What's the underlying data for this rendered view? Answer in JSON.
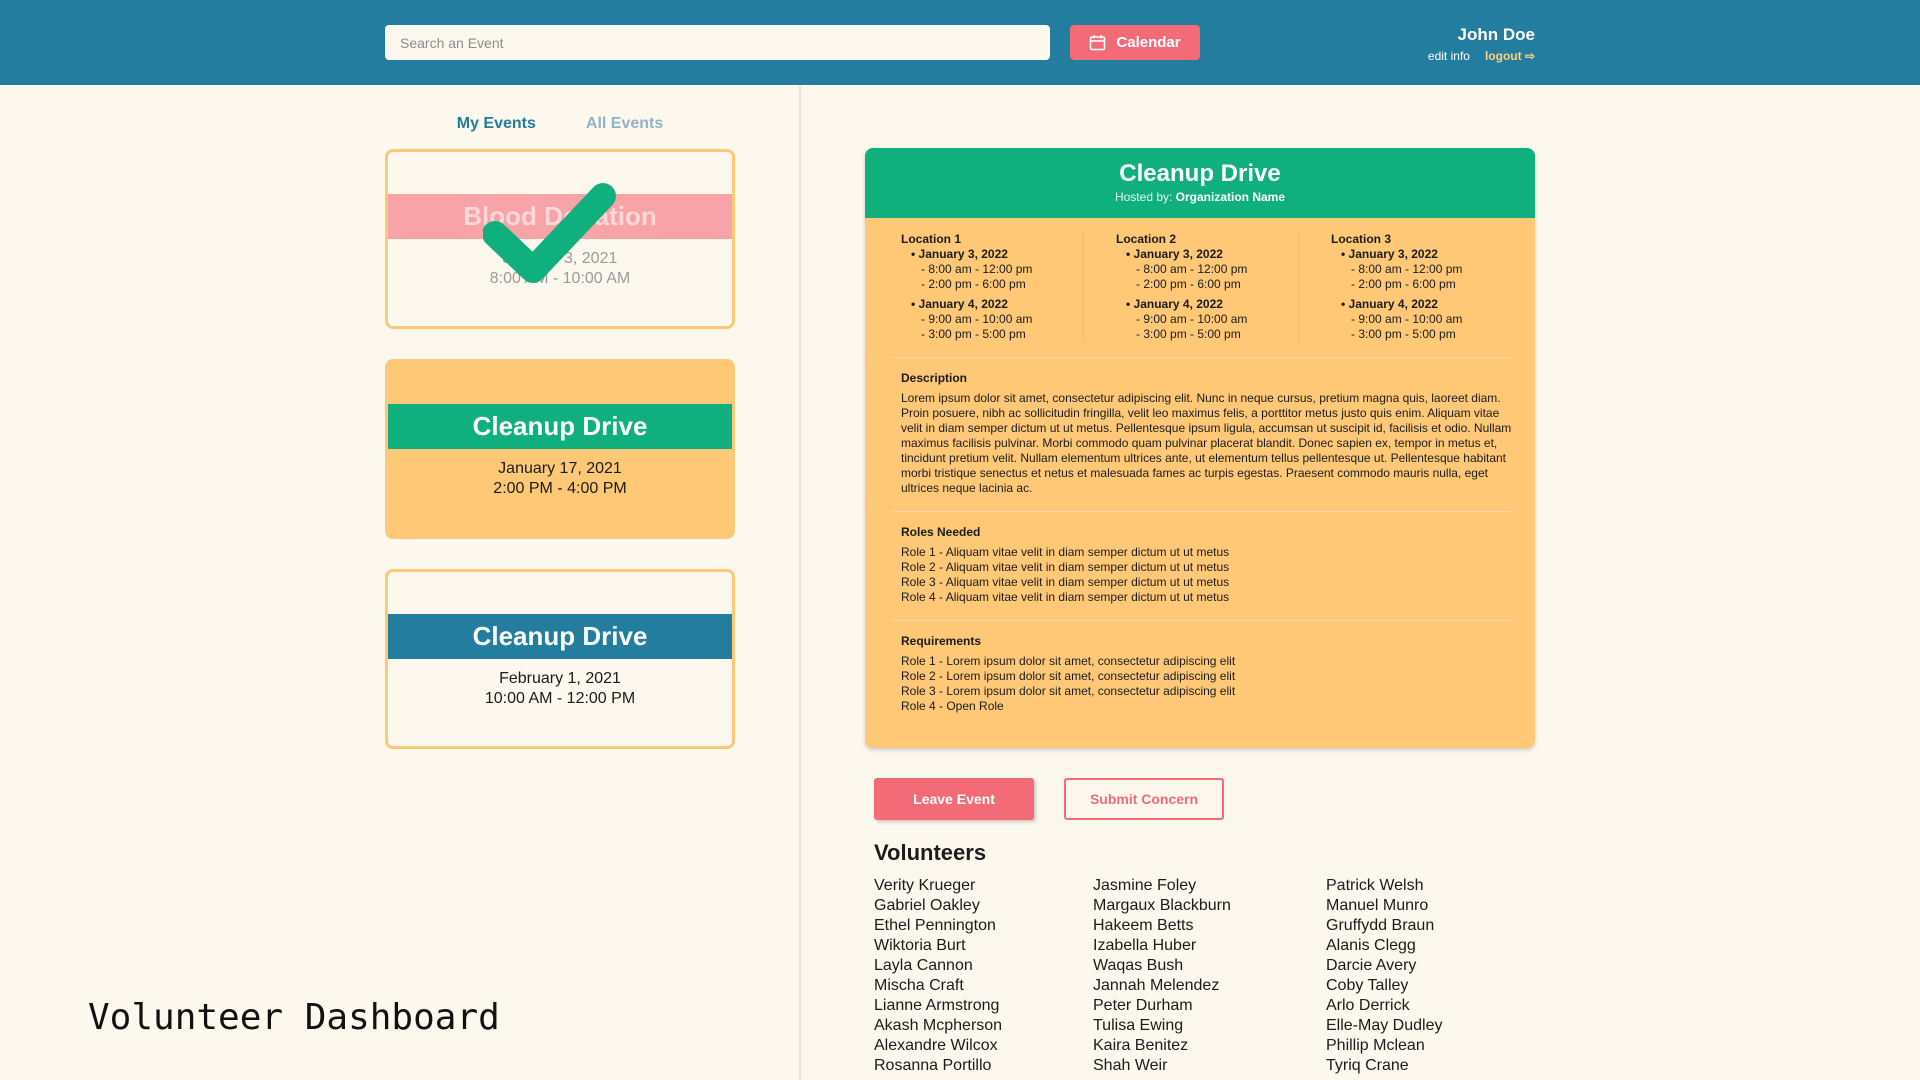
{
  "header": {
    "search_placeholder": "Search an Event",
    "calendar_label": "Calendar",
    "user_name": "John Doe",
    "edit_info": "edit info",
    "logout": "logout ⇨"
  },
  "tabs": {
    "my_events": "My Events",
    "all_events": "All Events"
  },
  "event_cards": [
    {
      "title": "Blood Donation",
      "date": "January 3, 2021",
      "time": "8:00 AM - 10:00 AM",
      "status": "completed"
    },
    {
      "title": "Cleanup Drive",
      "date": "January 17, 2021",
      "time": "2:00 PM - 4:00 PM",
      "status": "selected"
    },
    {
      "title": "Cleanup Drive",
      "date": "February 1, 2021",
      "time": "10:00 AM - 12:00 PM",
      "status": "upcoming"
    }
  ],
  "detail": {
    "title": "Cleanup Drive",
    "hosted_by_label": "Hosted by: ",
    "organization": "Organization Name",
    "locations": [
      {
        "name": "Location 1",
        "d1": "January 3, 2022",
        "d1t1": "8:00 am - 12:00 pm",
        "d1t2": "2:00 pm - 6:00 pm",
        "d2": "January 4, 2022",
        "d2t1": "9:00 am - 10:00 am",
        "d2t2": "3:00 pm - 5:00 pm"
      },
      {
        "name": "Location 2",
        "d1": "January 3, 2022",
        "d1t1": "8:00 am - 12:00 pm",
        "d1t2": "2:00 pm - 6:00 pm",
        "d2": "January 4, 2022",
        "d2t1": "9:00 am - 10:00 am",
        "d2t2": "3:00 pm - 5:00 pm"
      },
      {
        "name": "Location 3",
        "d1": "January 3, 2022",
        "d1t1": "8:00 am - 12:00 pm",
        "d1t2": "2:00 pm - 6:00 pm",
        "d2": "January 4, 2022",
        "d2t1": "9:00 am - 10:00 am",
        "d2t2": "3:00 pm - 5:00 pm"
      }
    ],
    "description_title": "Description",
    "description": "Lorem ipsum dolor sit amet, consectetur adipiscing elit. Nunc in neque cursus, pretium magna quis, laoreet diam. Proin posuere, nibh ac sollicitudin fringilla, velit leo maximus felis, a porttitor metus justo quis enim. Aliquam vitae velit in diam semper dictum ut ut metus. Pellentesque ipsum ligula, accumsan ut suscipit id, facilisis et odio. Nullam maximus facilisis pulvinar. Morbi commodo quam pulvinar placerat blandit. Donec sapien ex, tempor in metus et, tincidunt pretium velit. Nullam elementum ultrices ante, ut elementum tellus pellentesque ut. Pellentesque habitant morbi tristique senectus et netus et malesuada fames ac turpis egestas. Praesent commodo mauris nulla, eget ultrices neque lacinia ac.",
    "roles_title": "Roles Needed",
    "roles": [
      "Role 1 - Aliquam vitae velit in diam semper dictum ut ut metus",
      "Role 2 - Aliquam vitae velit in diam semper dictum ut ut metus",
      "Role 3 - Aliquam vitae velit in diam semper dictum ut ut metus",
      "Role 4 - Aliquam vitae velit in diam semper dictum ut ut metus"
    ],
    "requirements_title": "Requirements",
    "requirements": [
      "Role 1 - Lorem ipsum dolor sit amet, consectetur adipiscing elit",
      "Role 2 - Lorem ipsum dolor sit amet, consectetur adipiscing elit",
      "Role 3 - Lorem ipsum dolor sit amet, consectetur adipiscing elit",
      "Role 4 - Open Role"
    ]
  },
  "actions": {
    "leave": "Leave Event",
    "concern": "Submit Concern"
  },
  "volunteers_title": "Volunteers",
  "volunteers": [
    [
      "Verity Krueger",
      "Gabriel Oakley",
      "Ethel Pennington",
      "Wiktoria Burt",
      "Layla Cannon",
      "Mischa Craft",
      "Lianne Armstrong",
      "Akash Mcpherson",
      "Alexandre Wilcox",
      "Rosanna Portillo"
    ],
    [
      "Jasmine Foley",
      "Margaux Blackburn",
      "Hakeem Betts",
      "Izabella Huber",
      "Waqas Bush",
      "Jannah Melendez",
      "Peter Durham",
      "Tulisa Ewing",
      "Kaira Benitez",
      "Shah Weir"
    ],
    [
      "Patrick Welsh",
      "Manuel Munro",
      "Gruffydd Braun",
      "Alanis Clegg",
      "Darcie Avery",
      "Coby Talley",
      "Arlo Derrick",
      "Elle-May Dudley",
      "Phillip Mclean",
      "Tyriq Crane"
    ]
  ],
  "page_title": "Volunteer Dashboard",
  "colors": {
    "header": "#227d9e",
    "background": "#fcf8ee",
    "accent_red": "#f36b77",
    "accent_yellow": "#fec877",
    "accent_green": "#10b07e"
  },
  "icons": {
    "calendar": "calendar-icon",
    "checkmark": "checkmark-icon"
  }
}
